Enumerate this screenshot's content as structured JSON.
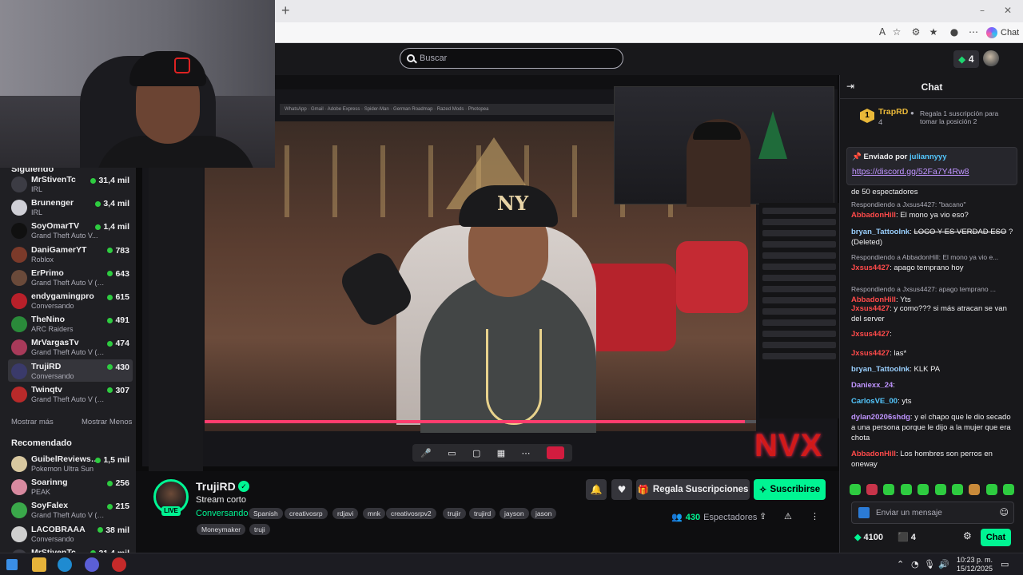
{
  "search": {
    "placeholder": "Buscar"
  },
  "browser": {
    "chat_label": "Chat"
  },
  "header": {
    "badge_count": "4"
  },
  "sidebar": {
    "following_title": "Siguiendo",
    "recommended_title": "Recomendado",
    "show_more": "Mostrar más",
    "show_less": "Mostrar Menos",
    "following": [
      {
        "name": "MrStivenTc",
        "category": "IRL",
        "viewers": "31,4 mil",
        "color": "#3c3c44"
      },
      {
        "name": "Brunenger",
        "category": "IRL",
        "viewers": "3,4 mil",
        "color": "#cfcfd6"
      },
      {
        "name": "SoyOmarTV",
        "category": "Grand Theft Auto V...",
        "viewers": "1,4 mil",
        "color": "#101010"
      },
      {
        "name": "DaniGamerYT",
        "category": "Roblox",
        "viewers": "783",
        "color": "#7b3a2a"
      },
      {
        "name": "ErPrimo",
        "category": "Grand Theft Auto V (G...",
        "viewers": "643",
        "color": "#6a4a3a"
      },
      {
        "name": "endygamingpro",
        "category": "Conversando",
        "viewers": "615",
        "color": "#b8202a"
      },
      {
        "name": "TheNino",
        "category": "ARC Raiders",
        "viewers": "491",
        "color": "#2a8a3a"
      },
      {
        "name": "MrVargasTv",
        "category": "Grand Theft Auto V (G...",
        "viewers": "474",
        "color": "#a83a5a"
      },
      {
        "name": "TrujiRD",
        "category": "Conversando",
        "viewers": "430",
        "color": "#3a3a6a"
      },
      {
        "name": "Twinqtv",
        "category": "Grand Theft Auto V (G...",
        "viewers": "307",
        "color": "#b82a2a"
      }
    ],
    "recommended": [
      {
        "name": "GuibelReviewsD...",
        "category": "Pokemon Ultra Sun",
        "viewers": "1,5 mil",
        "color": "#d8c8a0"
      },
      {
        "name": "Soarinng",
        "category": "PEAK",
        "viewers": "256",
        "color": "#d88aa0"
      },
      {
        "name": "SoyFalex",
        "category": "Grand Theft Auto V (G...",
        "viewers": "215",
        "color": "#3aa84a"
      },
      {
        "name": "LACOBRAAA",
        "category": "Conversando",
        "viewers": "38 mil",
        "color": "#cfcfcf"
      },
      {
        "name": "MrStivenTc",
        "category": "",
        "viewers": "31,4 mil",
        "color": "#3c3c44"
      }
    ]
  },
  "channel": {
    "name": "TrujiRD",
    "live": "LIVE",
    "title": "Stream corto",
    "category": "Conversando",
    "tags": [
      "Spanish",
      "creativosrp",
      "rdjavi",
      "mnk",
      "creativosrpv2",
      "trujir",
      "trujird",
      "jayson",
      "jason",
      "Moneymaker",
      "truji"
    ],
    "gift_label": "Regala Suscripciones",
    "subscribe_label": "Suscribirse",
    "viewers_count": "430",
    "viewers_label": "Espectadores"
  },
  "chat": {
    "title": "Chat",
    "leader": {
      "rank": "1",
      "name": "TrapRD",
      "count": "4",
      "gift_text": "Regala 1 suscripción para tomar la posición 2"
    },
    "pinned": {
      "sent_by": "Enviado por",
      "user": "juliannyyy",
      "link": "https://discord.gg/52Fa7Y4Rw8"
    },
    "messages": [
      {
        "reply": "",
        "user": "",
        "user_color": "#efeff1",
        "text": "de 50 espectadores",
        "deleted": false
      },
      {
        "reply": "Respondiendo a Jxsus4427: \"bacano\"",
        "user": "AbbadonHill",
        "user_color": "#ff4a4a",
        "text": "El mono ya vio eso?",
        "deleted": false
      },
      {
        "reply": "",
        "user": "bryan_TattooInk",
        "user_color": "#9ad0ff",
        "text": "LOCO Y ES VERDAD ESO",
        "deleted": true,
        "suffix": "? (Deleted)"
      },
      {
        "reply": "Respondiendo a AbbadonHill: El mono ya vio e...",
        "user": "Jxsus4427",
        "user_color": "#ff4a4a",
        "text": "apago temprano hoy",
        "deleted": false
      },
      {
        "reply": "Respondiendo a Jxsus4427: apago temprano ...",
        "user": "AbbadonHill",
        "user_color": "#ff4a4a",
        "text": "Yts",
        "deleted": false
      },
      {
        "reply": "",
        "user": "Jxsus4427",
        "user_color": "#ff4a4a",
        "text": "y como??? si más atracan se van del server",
        "deleted": false
      },
      {
        "reply": "",
        "user": "Jxsus4427",
        "user_color": "#ff4a4a",
        "text": "",
        "deleted": false
      },
      {
        "reply": "",
        "user": "Jxsus4427",
        "user_color": "#ff4a4a",
        "text": "las*",
        "deleted": false
      },
      {
        "reply": "",
        "user": "bryan_TattooInk",
        "user_color": "#9ad0ff",
        "text": "KLK PA",
        "deleted": false
      },
      {
        "reply": "",
        "user": "Daniexx_24",
        "user_color": "#bf94ff",
        "text": "",
        "deleted": false
      },
      {
        "reply": "",
        "user": "CarlosVE_00",
        "user_color": "#54c8ff",
        "text": "yts",
        "deleted": false
      },
      {
        "reply": "",
        "user": "dylan20206shdg",
        "user_color": "#bf94ff",
        "text": "y el chapo que le dio secado a una persona porque le dijo a la mujer que era chota",
        "deleted": false
      },
      {
        "reply": "",
        "user": "AbbadonHill",
        "user_color": "#ff4a4a",
        "text": "Los hombres son perros en oneway",
        "deleted": false
      }
    ],
    "input_placeholder": "Enviar un mensaje",
    "points": "4100",
    "points2": "4",
    "chat_button": "Chat"
  },
  "taskbar": {
    "time": "10:23 p. m.",
    "date": "15/12/2025"
  },
  "video": {
    "overlay_logo": "NVX",
    "progress": 0.98
  }
}
